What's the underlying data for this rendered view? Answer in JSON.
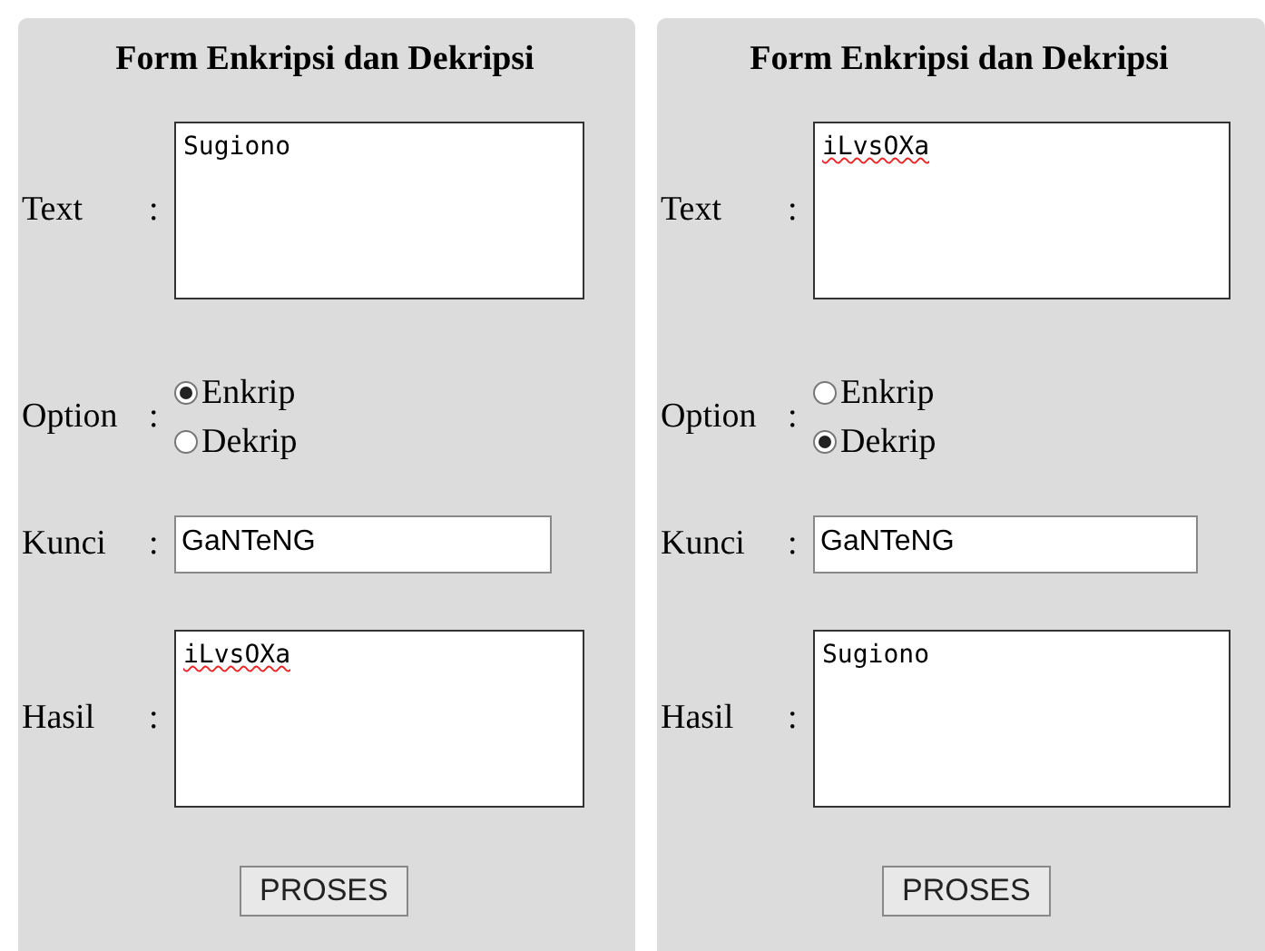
{
  "forms": [
    {
      "title": "Form Enkripsi dan Dekripsi",
      "colons": [
        ":",
        ":",
        ":",
        ":"
      ],
      "text_label": "Text",
      "text": {
        "value": "Sugiono",
        "misspelled": false
      },
      "option_label": "Option",
      "options": [
        {
          "label": "Enkrip",
          "selected": true
        },
        {
          "label": "Dekrip",
          "selected": false
        }
      ],
      "key_label": "Kunci",
      "key": "GaNTeNG",
      "result_label": "Hasil",
      "result": {
        "value": "iLvsOXa",
        "misspelled": true
      },
      "button": "PROSES"
    },
    {
      "title": "Form Enkripsi dan Dekripsi",
      "colons": [
        ":",
        ":",
        ":",
        ":"
      ],
      "text_label": "Text",
      "text": {
        "value": "iLvsOXa",
        "misspelled": true
      },
      "option_label": "Option",
      "options": [
        {
          "label": "Enkrip",
          "selected": false
        },
        {
          "label": "Dekrip",
          "selected": true
        }
      ],
      "key_label": "Kunci",
      "key": "GaNTeNG",
      "result_label": "Hasil",
      "result": {
        "value": "Sugiono",
        "misspelled": false
      },
      "button": "PROSES"
    }
  ]
}
